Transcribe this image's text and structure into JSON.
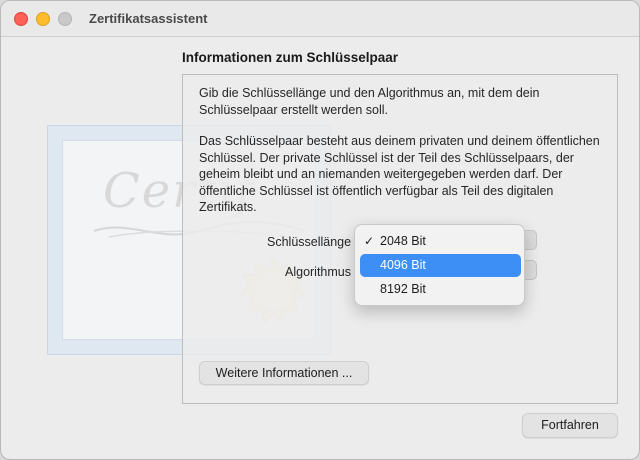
{
  "window": {
    "title": "Zertifikatsassistent"
  },
  "section": {
    "heading": "Informationen zum Schlüsselpaar",
    "paragraph1": "Gib die Schlüssellänge und den Algorithmus an, mit dem dein Schlüsselpaar erstellt werden soll.",
    "paragraph2": "Das Schlüsselpaar besteht aus deinem privaten und deinem öffentlichen Schlüssel. Der private Schlüssel ist der Teil des Schlüsselpaars, der geheim bleibt und an niemanden weitergegeben werden darf. Der öffentliche Schlüssel ist öffentlich verfügbar als Teil des digitalen Zertifikats."
  },
  "form": {
    "key_length_label": "Schlüssellänge",
    "algorithm_label": "Algorithmus"
  },
  "dropdown": {
    "options": [
      {
        "label": "2048 Bit",
        "checked": true,
        "highlighted": false
      },
      {
        "label": "4096 Bit",
        "checked": false,
        "highlighted": true
      },
      {
        "label": "8192 Bit",
        "checked": false,
        "highlighted": false
      }
    ],
    "check_glyph": "✓"
  },
  "buttons": {
    "more_info": "Weitere Informationen ...",
    "continue": "Fortfahren"
  },
  "illustration": {
    "script_text": "Certif"
  },
  "colors": {
    "highlight": "#3d8ff6",
    "close": "#fe5f57",
    "minimize": "#febc2e"
  }
}
